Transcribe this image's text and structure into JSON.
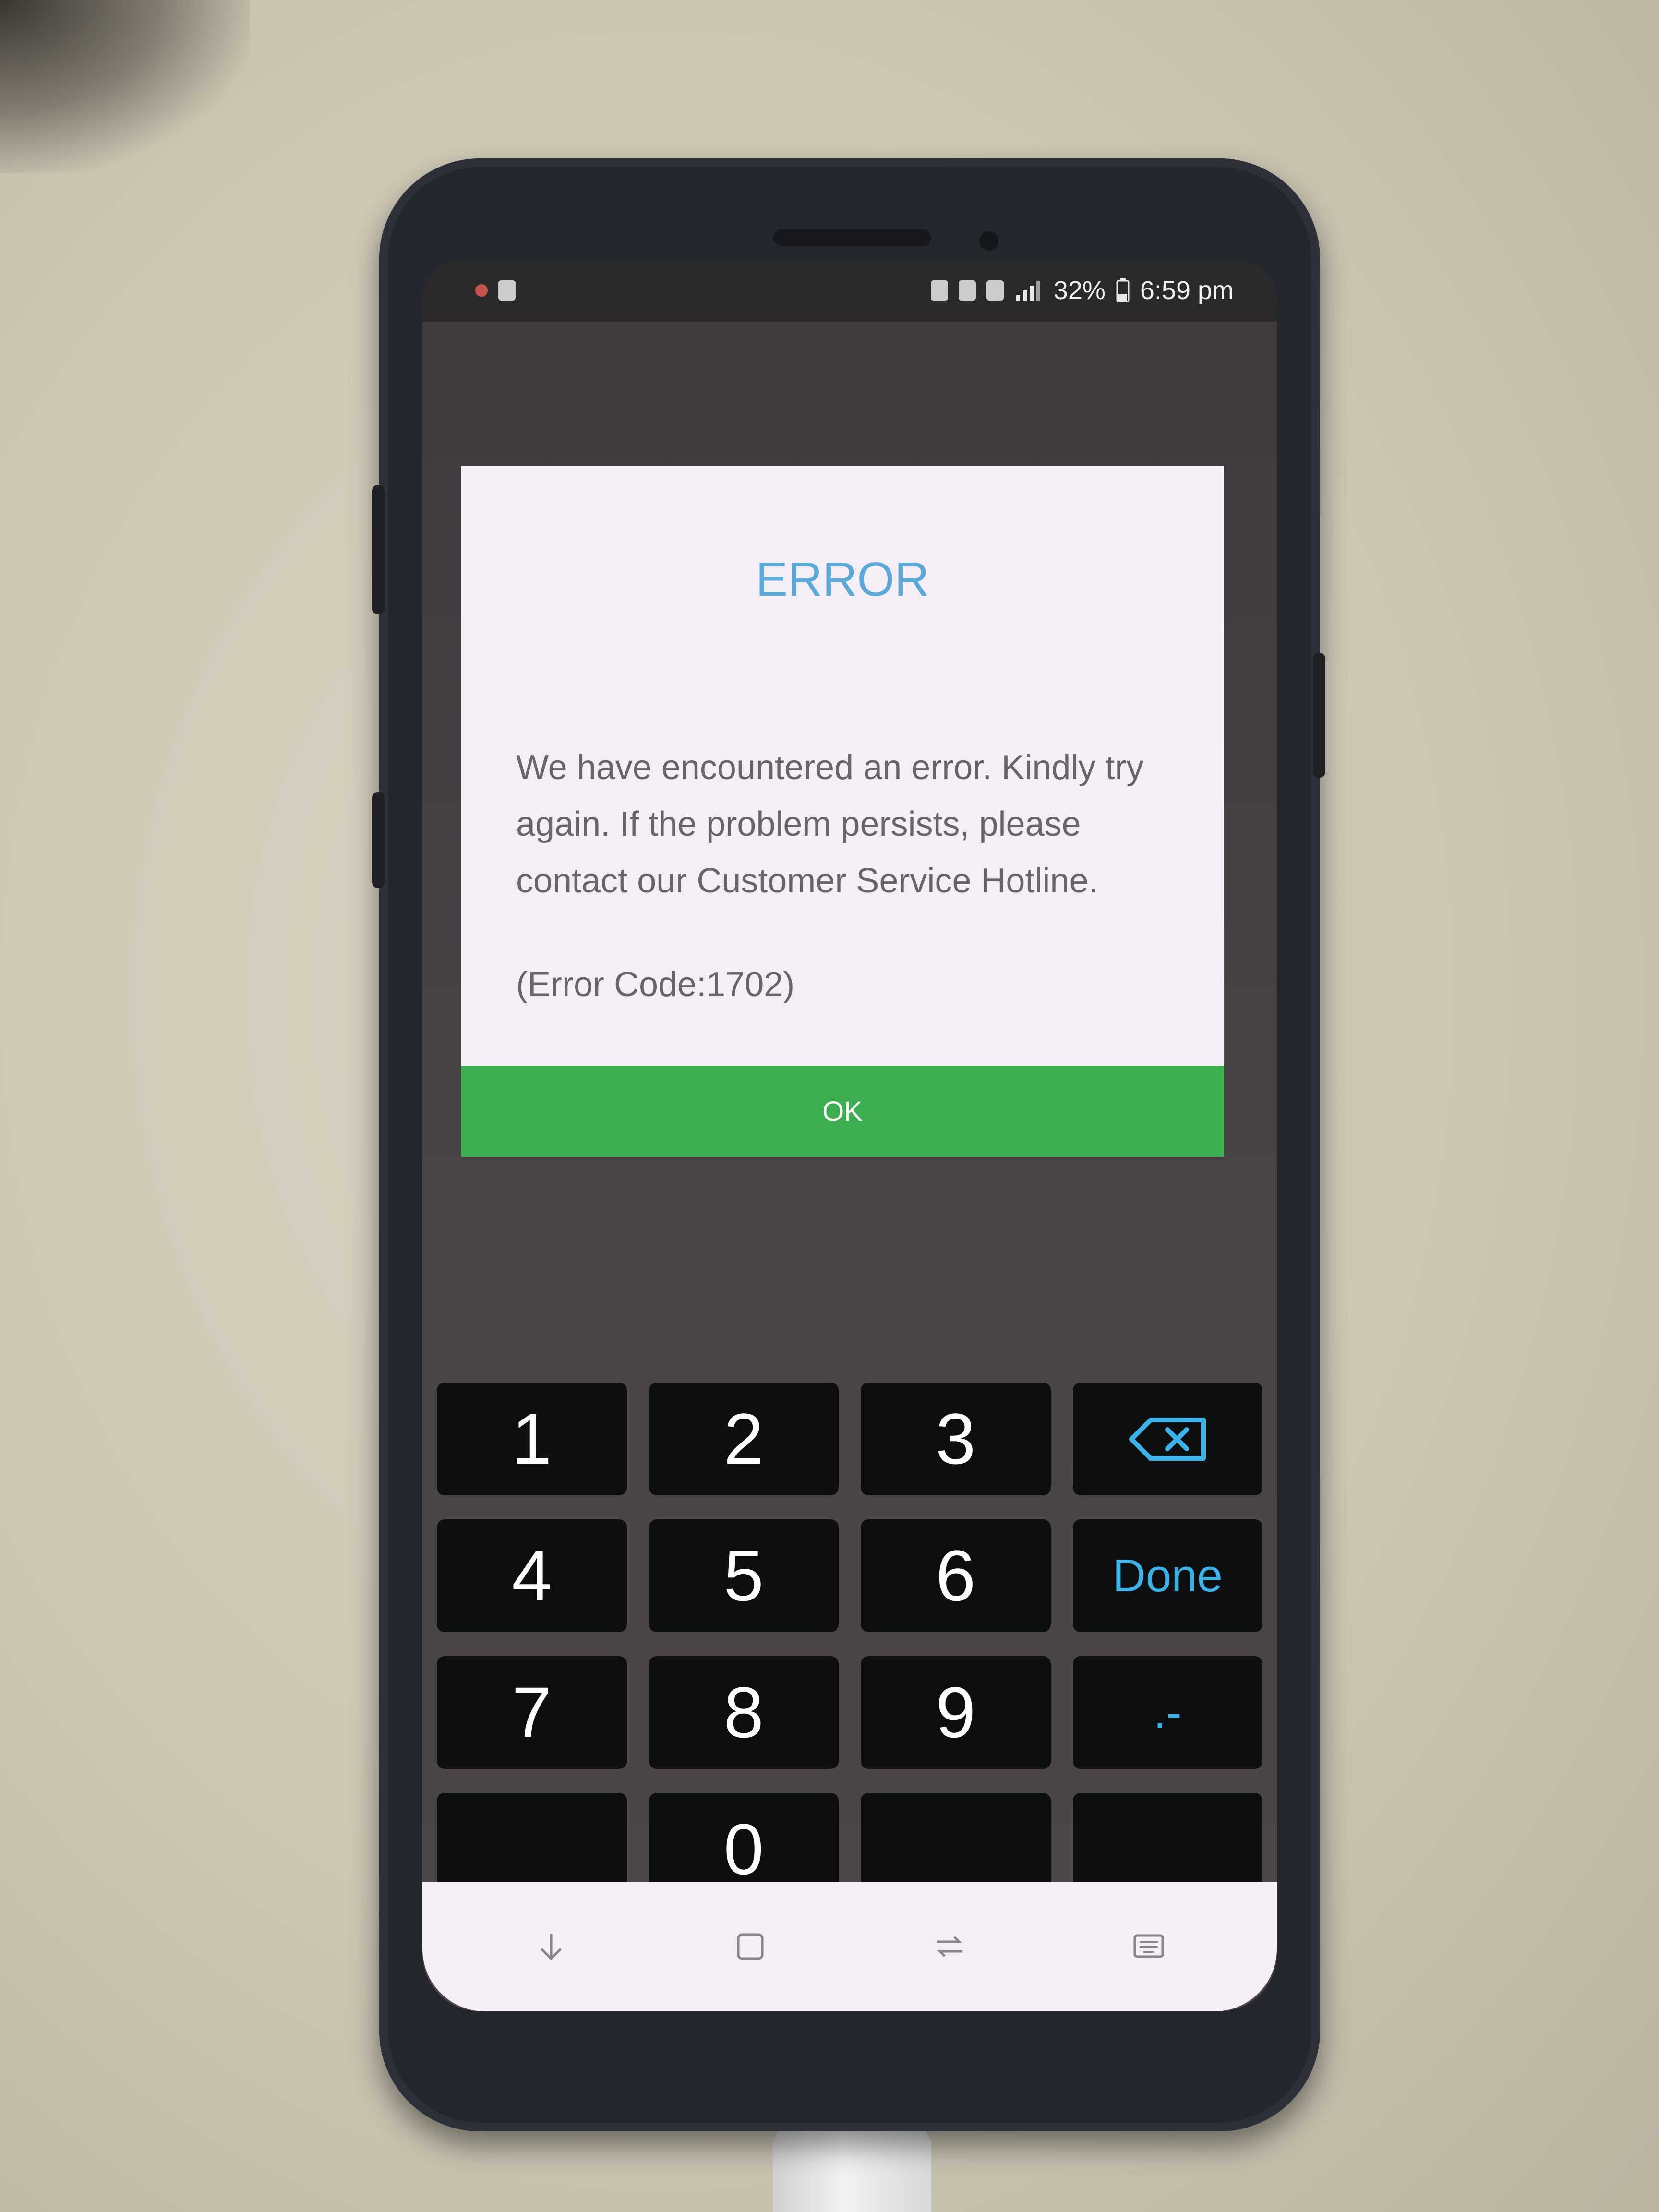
{
  "status_bar": {
    "battery": "32%",
    "time": "6:59 pm"
  },
  "dialog": {
    "title": "ERROR",
    "message": "We have encountered an error. Kindly try again. If the problem persists, please contact our Customer Service Hotline.",
    "error_code": "(Error Code:1702)",
    "ok_label": "OK"
  },
  "keypad": {
    "keys": [
      "1",
      "2",
      "3",
      "backspace",
      "4",
      "5",
      "6",
      "Done",
      "7",
      "8",
      "9",
      ".-",
      "",
      "0",
      "",
      ""
    ],
    "done_label": "Done",
    "punct_label": ".-"
  },
  "nav_bar": {
    "icons": [
      "hide-keyboard-icon",
      "home-icon",
      "recents-icon",
      "keyboard-switch-icon"
    ]
  },
  "colors": {
    "title": "#5aa9d8",
    "ok_button": "#3dae4f",
    "keypad_accent": "#3ab3e8"
  }
}
